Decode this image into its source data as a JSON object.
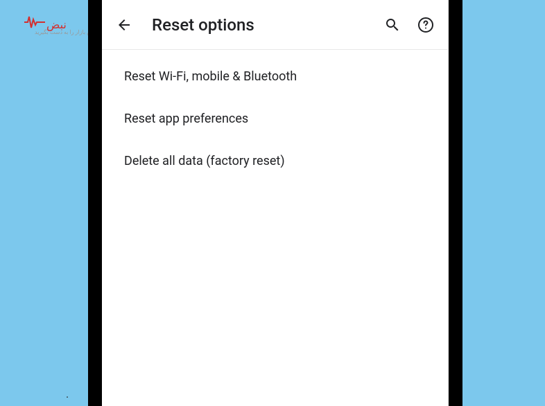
{
  "watermark": {
    "pulse": "⋀∿",
    "text": "نبض",
    "sub": "نبض بازار را به دست بگیرید"
  },
  "header": {
    "title": "Reset options"
  },
  "options": [
    {
      "label": "Reset Wi-Fi, mobile & Bluetooth"
    },
    {
      "label": "Reset app preferences"
    },
    {
      "label": "Delete all data (factory reset)"
    }
  ],
  "colors": {
    "background": "#7cc8ed",
    "accent": "#d32f2f",
    "text": "#202124"
  }
}
